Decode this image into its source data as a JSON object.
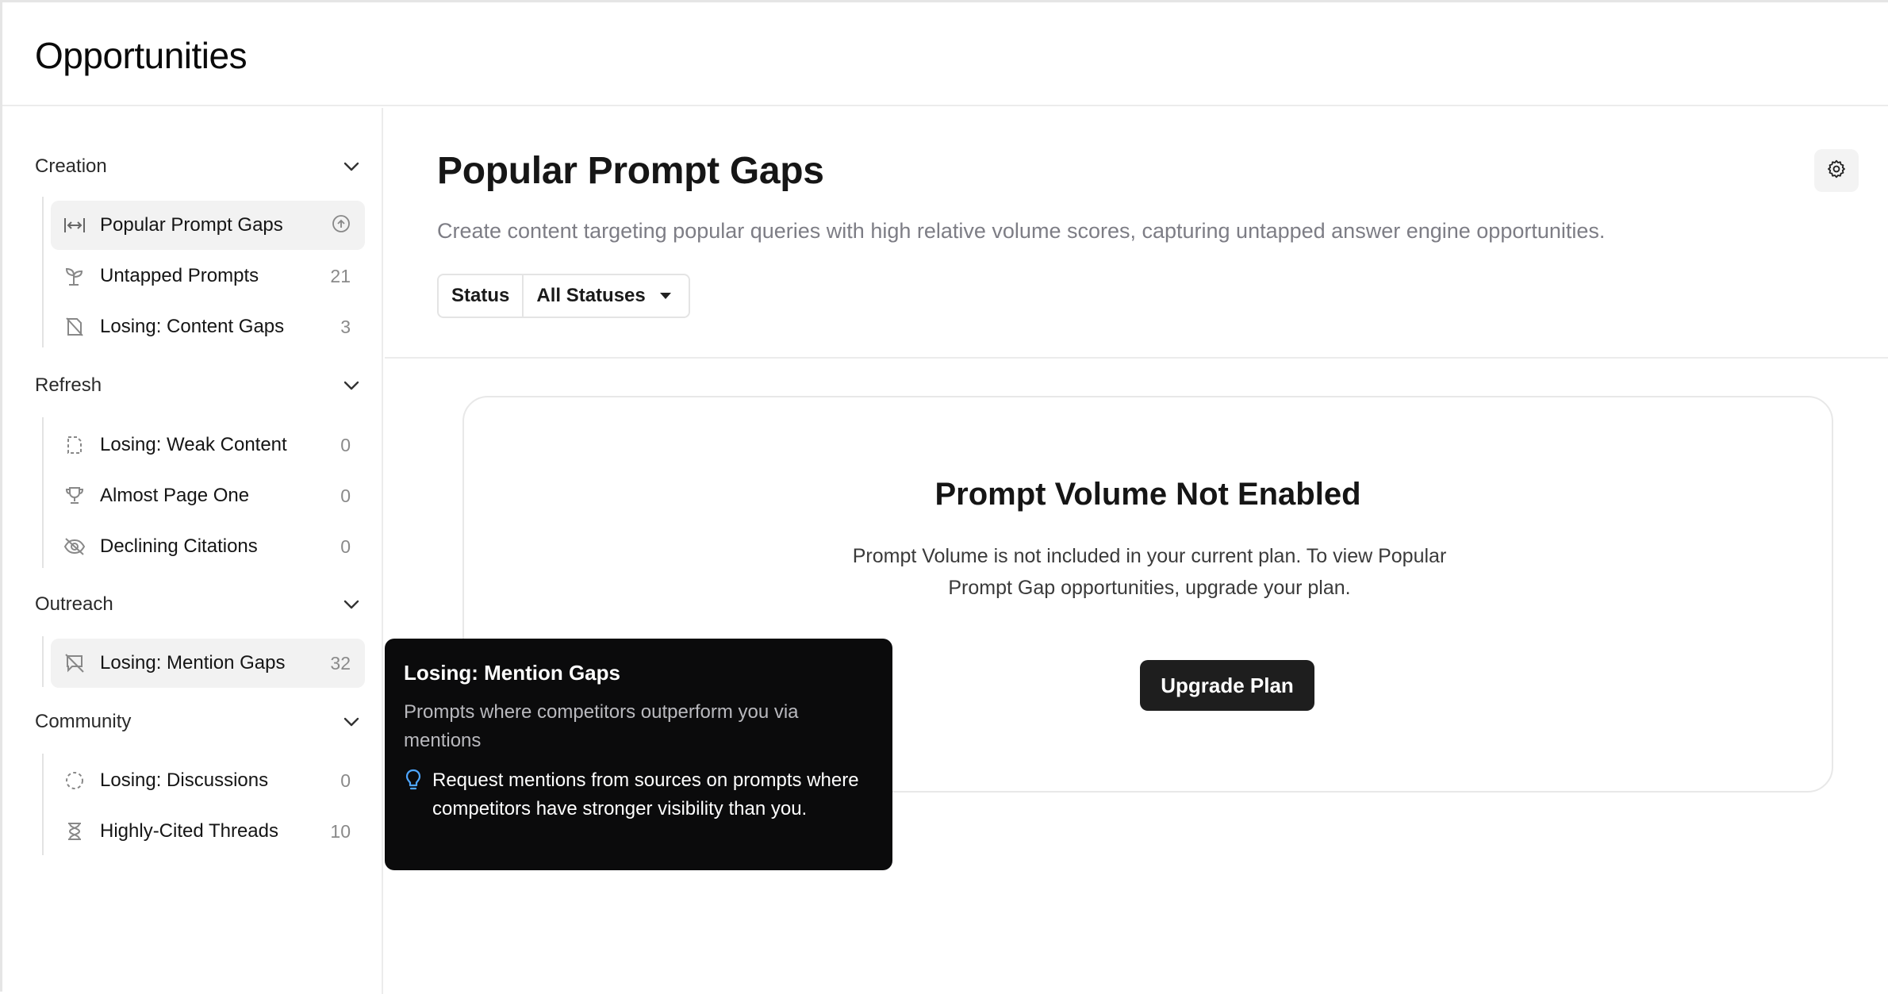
{
  "app": {
    "title": "Opportunities"
  },
  "sidebar": {
    "groups": [
      {
        "label": "Creation",
        "items": [
          {
            "label": "Popular Prompt Gaps",
            "count": "",
            "icon": "arrows-horizontal-icon",
            "active": true
          },
          {
            "label": "Untapped Prompts",
            "count": "21",
            "icon": "sprout-icon"
          },
          {
            "label": "Losing: Content Gaps",
            "count": "3",
            "icon": "file-off-icon"
          }
        ]
      },
      {
        "label": "Refresh",
        "items": [
          {
            "label": "Losing: Weak Content",
            "count": "0",
            "icon": "file-dashed-icon"
          },
          {
            "label": "Almost Page One",
            "count": "0",
            "icon": "trophy-icon"
          },
          {
            "label": "Declining Citations",
            "count": "0",
            "icon": "eye-off-icon"
          }
        ]
      },
      {
        "label": "Outreach",
        "items": [
          {
            "label": "Losing: Mention Gaps",
            "count": "32",
            "icon": "message-off-icon",
            "hovered": true
          }
        ]
      },
      {
        "label": "Community",
        "items": [
          {
            "label": "Losing: Discussions",
            "count": "0",
            "icon": "circle-dashed-icon"
          },
          {
            "label": "Highly-Cited Threads",
            "count": "10",
            "icon": "hourglass-icon"
          }
        ]
      }
    ]
  },
  "main": {
    "title": "Popular Prompt Gaps",
    "description": "Create content targeting popular queries with high relative volume scores, capturing untapped answer engine opportunities.",
    "filter": {
      "label": "Status",
      "value": "All Statuses"
    },
    "empty_state": {
      "title": "Prompt Volume Not Enabled",
      "text": "Prompt Volume is not included in your current plan. To view Popular Prompt Gap opportunities, upgrade your plan.",
      "button": "Upgrade Plan"
    }
  },
  "tooltip": {
    "title": "Losing: Mention Gaps",
    "description": "Prompts where competitors outperform you via mentions",
    "hint": "Request mentions from sources on prompts where competitors have stronger visibility than you."
  },
  "colors": {
    "accent_hint": "#4ea6ff",
    "button_bg": "#1e1e1e",
    "tooltip_bg": "#0b0b0c"
  }
}
